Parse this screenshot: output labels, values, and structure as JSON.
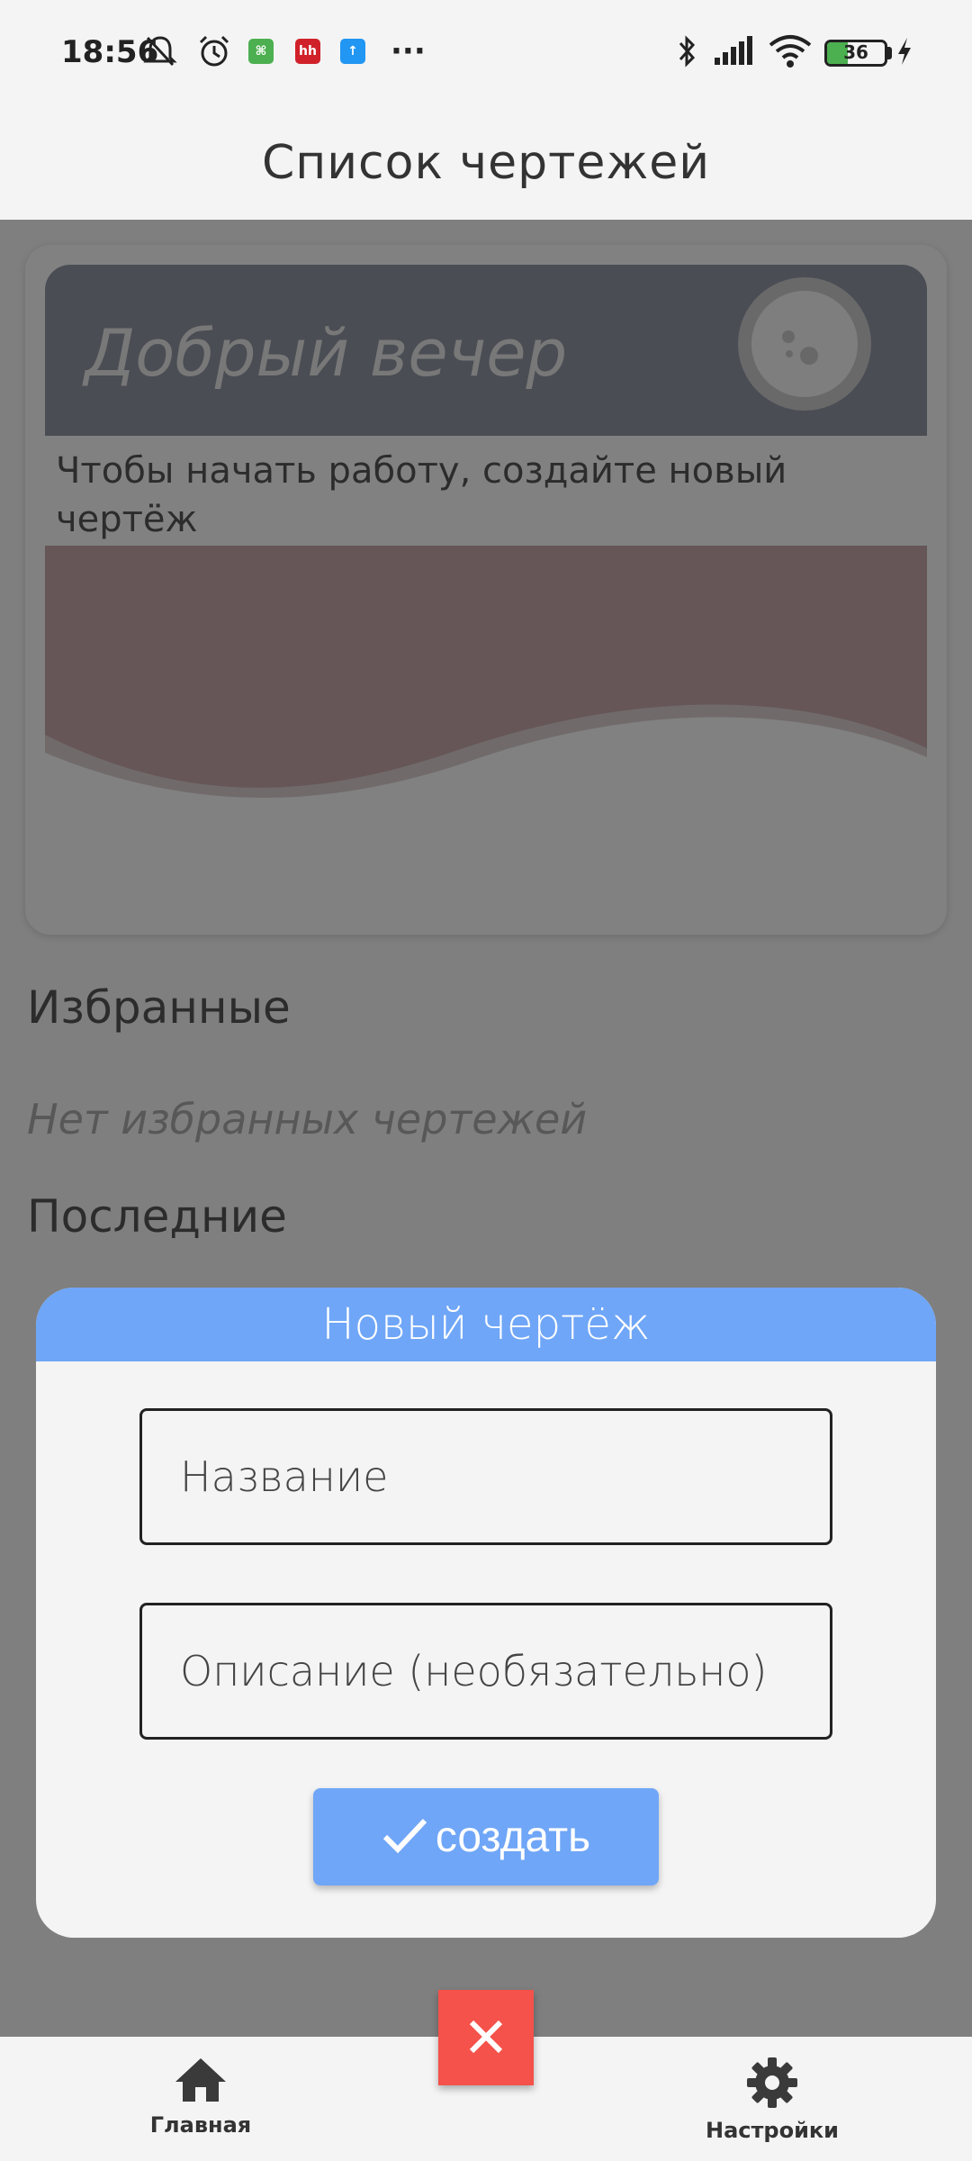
{
  "status_bar": {
    "time": "18:56",
    "battery_percent": "36",
    "app_badges": [
      "hh"
    ],
    "more": "···"
  },
  "app_bar": {
    "title": "Список чертежей"
  },
  "greeting": {
    "title": "Добрый вечер",
    "subtitle": "Чтобы начать работу, создайте новый чертёж"
  },
  "sections": {
    "favorites_title": "Избранные",
    "favorites_empty": "Нет избранных чертежей",
    "recent_title": "Последние"
  },
  "dialog": {
    "title": "Новый чертёж",
    "name_placeholder": "Название",
    "description_placeholder": "Описание (необязательно)",
    "create_label": "создать"
  },
  "bottom_nav": {
    "home_label": "Главная",
    "settings_label": "Настройки"
  },
  "colors": {
    "accent": "#6fa6f7",
    "close_button": "#f4524a",
    "greeting_header": "#8f95a0"
  }
}
